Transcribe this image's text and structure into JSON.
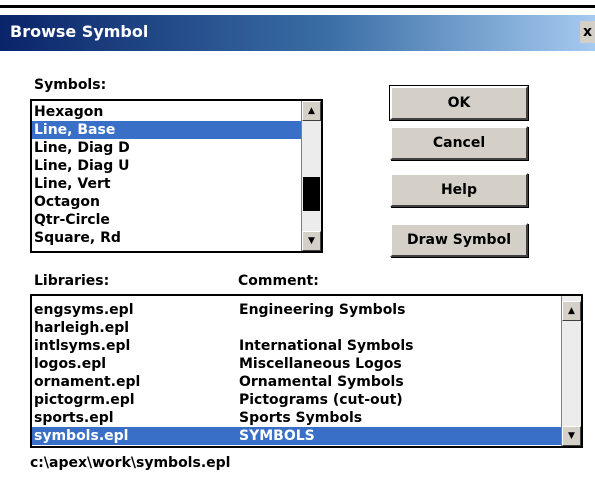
{
  "window": {
    "title": "Browse Symbol",
    "close_glyph": "x"
  },
  "symbols": {
    "label": "Symbols:",
    "items": [
      "Hexagon",
      "Line, Base",
      "Line, Diag D",
      "Line, Diag U",
      "Line, Vert",
      "Octagon",
      "Qtr-Circle",
      "Square, Rd"
    ],
    "selected": "Line, Base"
  },
  "buttons": {
    "ok": "OK",
    "cancel": "Cancel",
    "help": "Help",
    "draw_symbol": "Draw Symbol"
  },
  "libraries": {
    "label": "Libraries:",
    "comment_label": "Comment:",
    "rows": [
      {
        "name": "engsyms.epl",
        "comment": "Engineering Symbols"
      },
      {
        "name": "harleigh.epl",
        "comment": ""
      },
      {
        "name": "intlsyms.epl",
        "comment": "International Symbols"
      },
      {
        "name": "logos.epl",
        "comment": "Miscellaneous Logos"
      },
      {
        "name": "ornament.epl",
        "comment": "Ornamental Symbols"
      },
      {
        "name": "pictogrm.epl",
        "comment": "Pictograms (cut-out)"
      },
      {
        "name": "sports.epl",
        "comment": "Sports Symbols"
      },
      {
        "name": "symbols.epl",
        "comment": "SYMBOLS"
      }
    ],
    "selected": "symbols.epl"
  },
  "path": "c:\\apex\\work\\symbols.epl",
  "colors": {
    "selection": "#3a6fc7",
    "titlebar": "#0a246a",
    "button_face": "#d4d0c8"
  },
  "icons": {
    "scroll_up": "triangle-up-icon",
    "scroll_down": "triangle-down-icon"
  }
}
